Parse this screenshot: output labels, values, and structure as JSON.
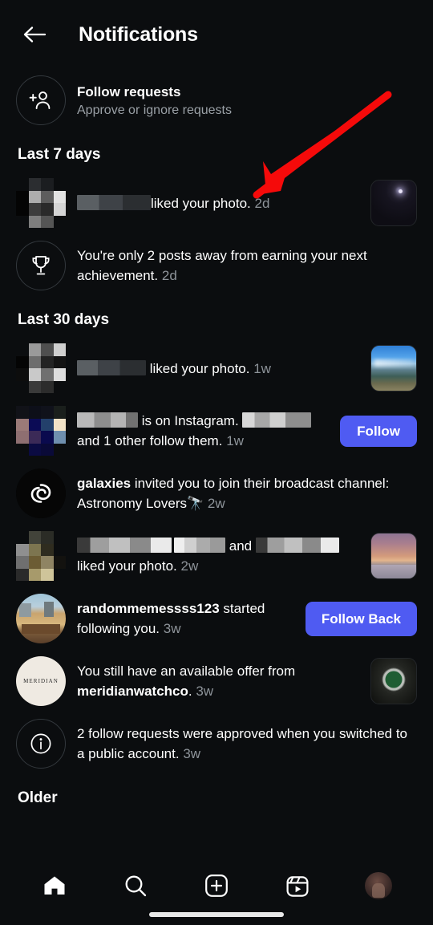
{
  "header": {
    "back_icon": "arrow-left-icon",
    "title": "Notifications"
  },
  "follow_requests": {
    "icon": "person-add-icon",
    "title": "Follow requests",
    "subtitle": "Approve or ignore requests"
  },
  "sections": [
    {
      "id": "last7",
      "heading": "Last 7 days"
    },
    {
      "id": "last30",
      "heading": "Last 30 days"
    },
    {
      "id": "older",
      "heading": "Older"
    }
  ],
  "notifications": {
    "liked_photo_2d": {
      "avatar": "redacted-pixelated-avatar",
      "username": "[redacted]",
      "text": "liked your photo.",
      "time": "2d",
      "thumbnail": "night-sky-photo"
    },
    "achievement_2d": {
      "icon": "trophy-icon",
      "text": "You're only 2 posts away from earning your next achievement.",
      "time": "2d"
    },
    "liked_photo_1w": {
      "avatar": "redacted-pixelated-avatar",
      "username": "[redacted]",
      "text": "liked your photo.",
      "time": "1w",
      "thumbnail": "mountain-landscape-photo"
    },
    "is_on_instagram_1w": {
      "avatar": "redacted-pixelated-avatar",
      "username": "[redacted]",
      "text_mid": "is on Instagram.",
      "text_end": "and 1 other follow them.",
      "time": "1w",
      "action_label": "Follow"
    },
    "broadcast_invite_2w": {
      "avatar": "galaxy-spiral-icon",
      "username": "galaxies",
      "text": "invited you to join their broadcast channel: Astronomy Lovers",
      "emoji": "🔭",
      "time": "2w"
    },
    "liked_photo_2w": {
      "avatar": "redacted-pixelated-avatar",
      "username_a": "[redacted]_",
      "username_b": "[redacted]",
      "conjunction": "and",
      "text": "liked your photo.",
      "time": "2w",
      "thumbnail": "sunset-ocean-photo"
    },
    "started_following_3w": {
      "avatar": "minecraft-desert-photo",
      "username": "randommemessss123",
      "text": "started following you.",
      "time": "3w",
      "action_label": "Follow Back"
    },
    "offer_3w": {
      "avatar": "meridian-logo",
      "avatar_label": "MERIDIAN",
      "text_start": "You still have an available offer from",
      "username": "meridianwatchco",
      "text_end": ".",
      "time": "3w",
      "thumbnail": "green-dial-watch-photo"
    },
    "requests_approved_3w": {
      "icon": "info-circle-icon",
      "text": "2 follow requests were approved when you switched to a public account.",
      "time": "3w"
    }
  },
  "bottom_nav": [
    {
      "id": "home",
      "icon": "home-icon",
      "active": true
    },
    {
      "id": "search",
      "icon": "search-icon",
      "active": false
    },
    {
      "id": "create",
      "icon": "plus-square-icon",
      "active": false
    },
    {
      "id": "reels",
      "icon": "reels-icon",
      "active": false
    },
    {
      "id": "profile",
      "icon": "profile-avatar-icon",
      "active": false
    }
  ],
  "annotation": {
    "type": "red-arrow",
    "color": "#f50a0a",
    "points_to": "liked your photo. 2d"
  },
  "colors": {
    "background": "#0b0d0f",
    "text_primary": "#ffffff",
    "text_secondary": "#9aa0a6",
    "accent_blue": "#4f5bf2",
    "annotation_red": "#f50a0a"
  }
}
